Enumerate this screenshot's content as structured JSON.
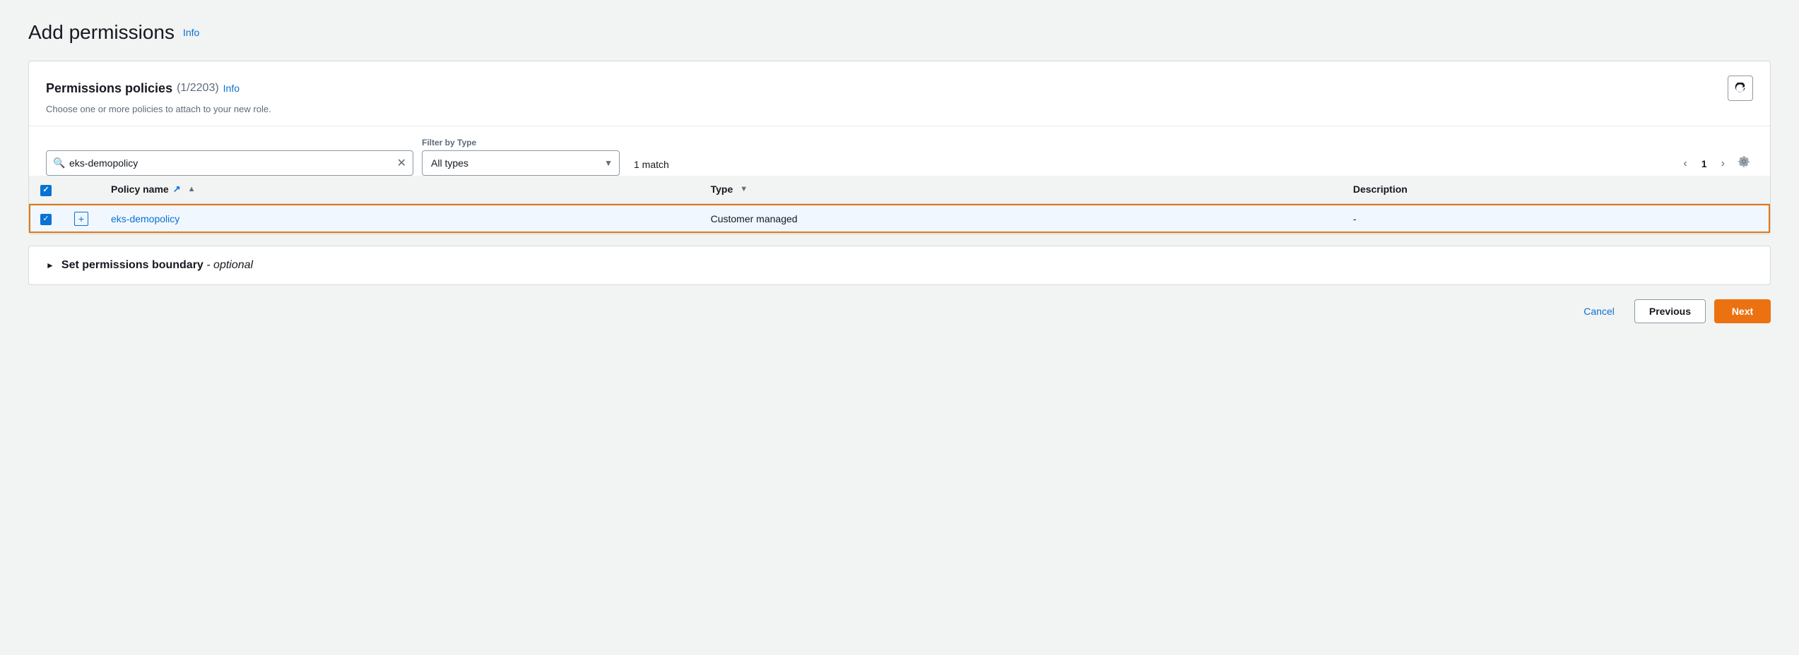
{
  "page": {
    "title": "Add permissions",
    "info_label": "Info"
  },
  "card": {
    "title": "Permissions policies",
    "count": "(1/2203)",
    "info_label": "Info",
    "subtitle": "Choose one or more policies to attach to your new role.",
    "refresh_label": "↻"
  },
  "filter": {
    "search_placeholder": "eks-demopolicy",
    "search_value": "eks-demopolicy",
    "filter_by_type_label": "Filter by Type",
    "type_value": "All types",
    "match_text": "1 match"
  },
  "pagination": {
    "current_page": "1",
    "prev_label": "‹",
    "next_label": "›"
  },
  "table": {
    "columns": [
      {
        "id": "checkbox",
        "label": ""
      },
      {
        "id": "expand",
        "label": ""
      },
      {
        "id": "policy_name",
        "label": "Policy name",
        "sort": "▲"
      },
      {
        "id": "type",
        "label": "Type",
        "sort": "▼"
      },
      {
        "id": "description",
        "label": "Description"
      }
    ],
    "rows": [
      {
        "checked": true,
        "expand_icon": "+",
        "policy_name": "eks-demopolicy",
        "type": "Customer managed",
        "description": "-",
        "selected": true
      }
    ]
  },
  "boundary": {
    "title": "Set permissions boundary",
    "optional": "- optional"
  },
  "footer": {
    "cancel_label": "Cancel",
    "previous_label": "Previous",
    "next_label": "Next"
  }
}
